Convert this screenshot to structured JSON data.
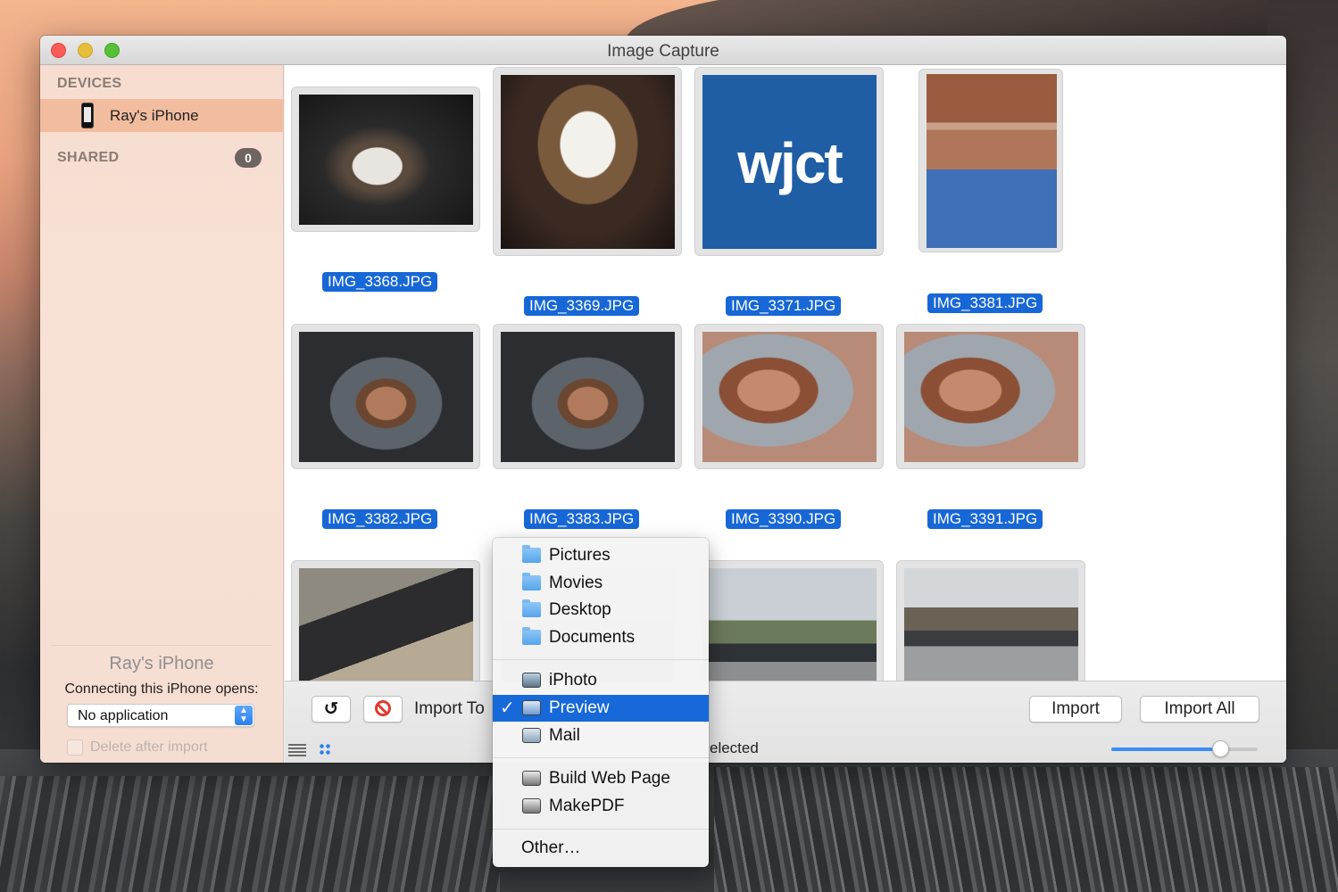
{
  "window": {
    "title": "Image Capture"
  },
  "sidebar": {
    "devices_header": "DEVICES",
    "device_name": "Ray's iPhone",
    "shared_header": "SHARED",
    "shared_count": "0",
    "selected_device_title": "Ray's iPhone",
    "opens_label": "Connecting this iPhone opens:",
    "opens_value": "No application",
    "delete_after_import": "Delete after import"
  },
  "images": [
    {
      "name": "IMG_3368.JPG",
      "icon": "coffee-cup-photo"
    },
    {
      "name": "IMG_3369.JPG",
      "icon": "coffee-cup-photo"
    },
    {
      "name": "IMG_3371.JPG",
      "icon": "wjct-logo",
      "logo_text": "wjct"
    },
    {
      "name": "IMG_3381.JPG",
      "icon": "portrait-photo"
    },
    {
      "name": "IMG_3382.JPG",
      "icon": "portrait-photo"
    },
    {
      "name": "IMG_3383.JPG",
      "icon": "portrait-photo"
    },
    {
      "name": "IMG_3390.JPG",
      "icon": "portrait-photo"
    },
    {
      "name": "IMG_3391.JPG",
      "icon": "portrait-photo"
    },
    {
      "name": "",
      "icon": "street-photo"
    },
    {
      "name": "",
      "icon": "street-photo"
    },
    {
      "name": "",
      "icon": "street-photo"
    },
    {
      "name": "",
      "icon": "street-photo"
    }
  ],
  "bottombar": {
    "import_to_label": "Import To",
    "status": "elected",
    "import_button": "Import",
    "import_all_button": "Import All",
    "thumbnail_size": 0.78
  },
  "import_menu": {
    "folders": [
      "Pictures",
      "Movies",
      "Desktop",
      "Documents"
    ],
    "apps": [
      "iPhoto",
      "Preview",
      "Mail"
    ],
    "selected": "Preview",
    "scripts": [
      "Build Web Page",
      "MakePDF"
    ],
    "other": "Other…"
  },
  "colors": {
    "selection_blue": "#1767d6",
    "sidebar_highlight": "#f2bc9f",
    "wjct_blue": "#1f5ea5",
    "wjct_yellow": "#f3b719"
  }
}
